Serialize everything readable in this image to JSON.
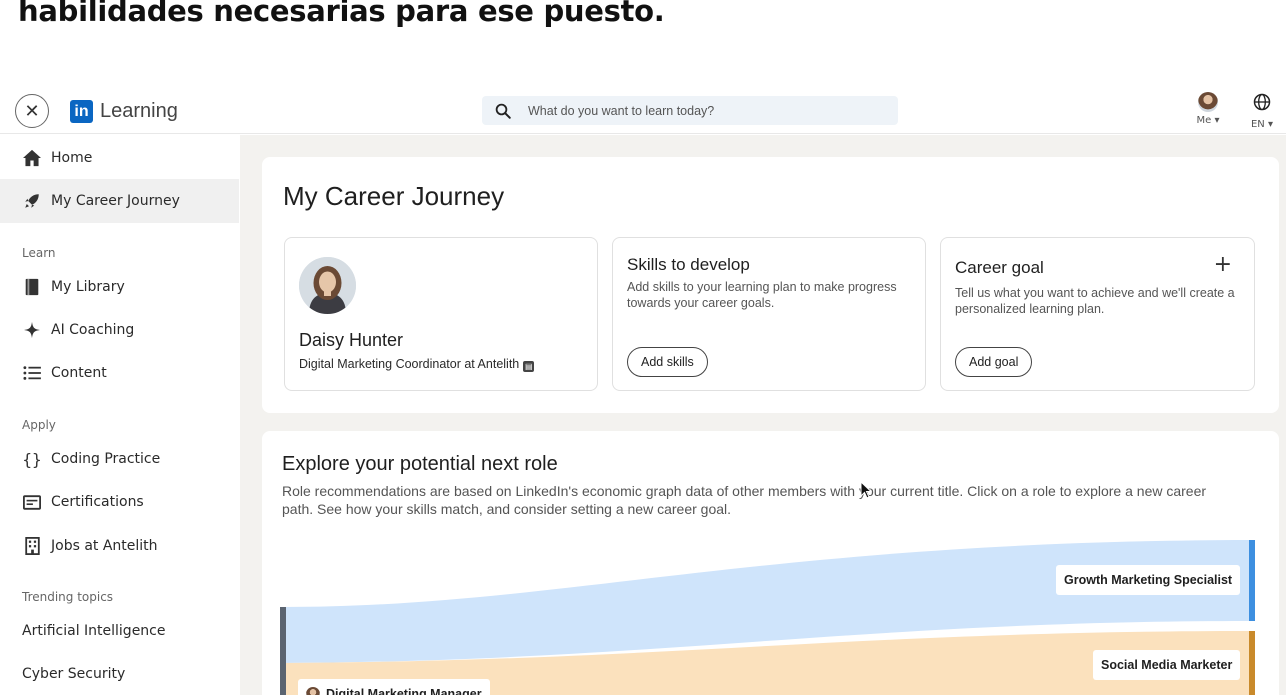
{
  "caption": "habilidades necesarias para ese puesto.",
  "topbar": {
    "logo_mark": "in",
    "logo_text": "Learning",
    "search_placeholder": "What do you want to learn today?",
    "me_label": "Me",
    "lang_label": "EN"
  },
  "sidebar": {
    "home": "Home",
    "career_journey": "My Career Journey",
    "learn_label": "Learn",
    "my_library": "My Library",
    "ai_coaching": "AI Coaching",
    "content": "Content",
    "apply_label": "Apply",
    "coding_practice": "Coding Practice",
    "certifications": "Certifications",
    "jobs": "Jobs at Antelith",
    "trending_label": "Trending topics",
    "topic_ai": "Artificial Intelligence",
    "topic_cyber": "Cyber Security"
  },
  "main": {
    "title": "My Career Journey",
    "profile": {
      "name": "Daisy Hunter",
      "role": "Digital Marketing Coordinator at Antelith"
    },
    "skills": {
      "title": "Skills to develop",
      "desc": "Add skills to your learning plan to make progress towards your career goals.",
      "button": "Add skills"
    },
    "goal": {
      "title": "Career goal",
      "desc": "Tell us what you want to achieve and we'll create a personalized learning plan.",
      "button": "Add goal"
    },
    "explore": {
      "title": "Explore your potential next role",
      "desc": "Role recommendations are based on LinkedIn's economic graph data of other members with your current title. Click on a role to explore a new career path. See how your skills match, and consider setting a new career goal.",
      "roles": {
        "growth": "Growth Marketing Specialist",
        "social": "Social Media Marketer",
        "current": "Digital Marketing Manager"
      }
    }
  },
  "colors": {
    "brand": "#0a66c2",
    "flow_blue": "#cfe4fb",
    "flow_blue_bar": "#3d8fe0",
    "flow_orange": "#fbe1bd",
    "flow_orange_bar": "#c98a2b",
    "source_bar": "#5b6470"
  }
}
